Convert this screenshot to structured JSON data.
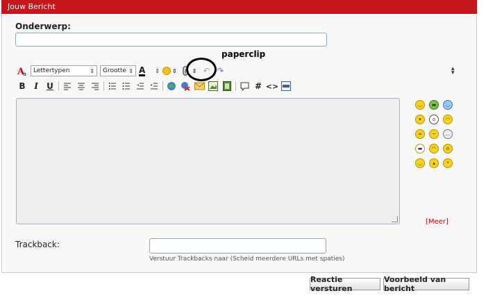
{
  "panel": {
    "title": "Jouw Bericht"
  },
  "form": {
    "subject_label": "Onderwerp:",
    "subject_value": "",
    "trackback_label": "Trackback:",
    "trackback_value": "",
    "trackback_hint": "Verstuur Trackbacks naar (Scheid meerdere URLs met spaties)"
  },
  "annotation": {
    "text": "paperclip"
  },
  "toolbar": {
    "font_select": "Lettertypen",
    "size_select": "Grootte",
    "font_color_letter": "A",
    "bold": "B",
    "italic": "I",
    "underline": "U",
    "hash": "#",
    "code": "<>"
  },
  "smilies": {
    "more_link": "[Meer]"
  },
  "actions": {
    "reply_button": "Reactie versturen",
    "preview_button": "Voorbeeld van bericht"
  },
  "colors": {
    "title_bar": "#c4161c",
    "more_link": "#cc0000"
  }
}
